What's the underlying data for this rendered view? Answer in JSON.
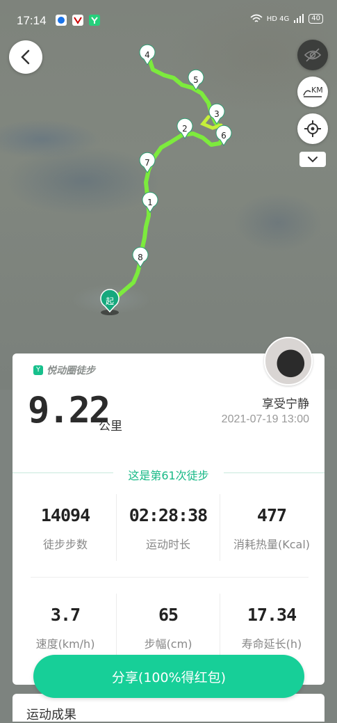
{
  "status_bar": {
    "time": "17:14",
    "right_text": "HD 4G",
    "battery": "40"
  },
  "map": {
    "start_label": "起",
    "markers": [
      "1",
      "2",
      "3",
      "4",
      "5",
      "6",
      "7",
      "8"
    ],
    "route_color": "#7cf03a"
  },
  "card": {
    "brand": "悦动圈徒步",
    "distance": "9.22",
    "distance_unit": "公里",
    "user_name": "享受宁静",
    "datetime": "2021-07-19 13:00",
    "session_note": "这是第61次徒步",
    "stats": [
      {
        "value": "14094",
        "label": "徒步步数"
      },
      {
        "value": "02:28:38",
        "label": "运动时长"
      },
      {
        "value": "477",
        "label": "消耗热量(Kcal)"
      },
      {
        "value": "3.7",
        "label": "速度(km/h)"
      },
      {
        "value": "65",
        "label": "步幅(cm)"
      },
      {
        "value": "17.34",
        "label": "寿命延长(h)"
      }
    ]
  },
  "share_button": "分享(100%得红包)",
  "bottom_card_partial": "运动成果"
}
